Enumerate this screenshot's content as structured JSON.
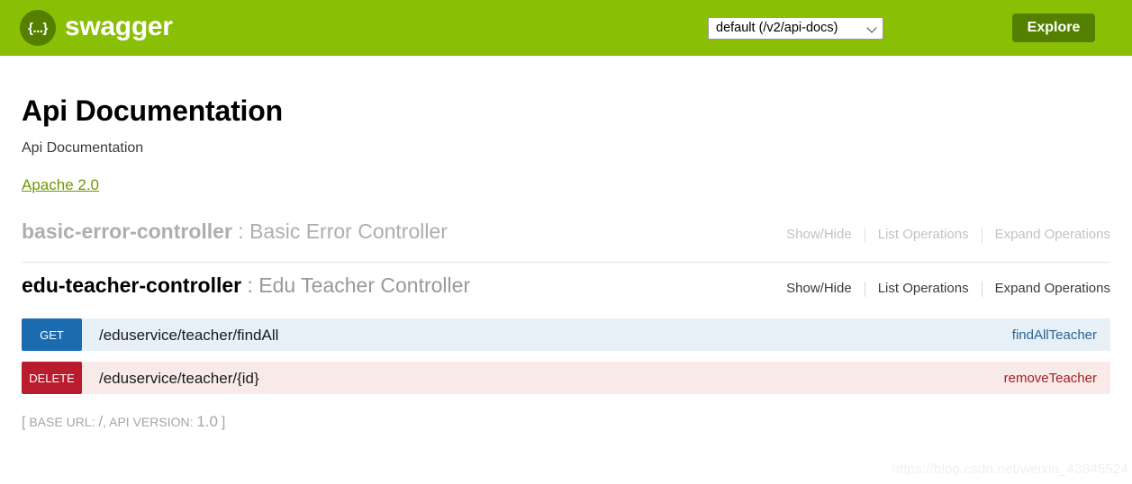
{
  "header": {
    "brand_glyph": "{...}",
    "brand_name": "swagger",
    "selector_value": "default (/v2/api-docs)",
    "selector_icon": "chevron-down-icon",
    "explore_label": "Explore"
  },
  "info": {
    "title": "Api Documentation",
    "description": "Api Documentation",
    "license_label": "Apache 2.0"
  },
  "resources": [
    {
      "name": "basic-error-controller",
      "separator": " : ",
      "description": "Basic Error Controller",
      "state": "dim",
      "operations": {
        "show_hide": "Show/Hide",
        "list_operations": "List Operations",
        "expand_operations": "Expand Operations"
      },
      "endpoints": []
    },
    {
      "name": "edu-teacher-controller",
      "separator": " : ",
      "description": "Edu Teacher Controller",
      "state": "active",
      "operations": {
        "show_hide": "Show/Hide",
        "list_operations": "List Operations",
        "expand_operations": "Expand Operations"
      },
      "endpoints": [
        {
          "method": "GET",
          "path": "/eduservice/teacher/findAll",
          "nickname": "findAllTeacher",
          "kind": "get"
        },
        {
          "method": "DELETE",
          "path": "/eduservice/teacher/{id}",
          "nickname": "removeTeacher",
          "kind": "delete"
        }
      ]
    }
  ],
  "footer": {
    "open_bracket": "[",
    "base_url_label": "BASE URL:",
    "base_url_value": "/",
    "comma": ",",
    "api_version_label": "API VERSION:",
    "api_version_value": "1.0",
    "close_bracket": "]"
  },
  "watermark": "https://blog.csdn.net/weixin_43845524",
  "colors": {
    "header_green": "#89bf04",
    "brand_dark_green": "#547f00",
    "link_green": "#6e9a00",
    "get_blue": "#1a6bb0",
    "get_row_bg": "#e7f0f7",
    "delete_red": "#b81c2d",
    "delete_row_bg": "#f9eaea"
  }
}
